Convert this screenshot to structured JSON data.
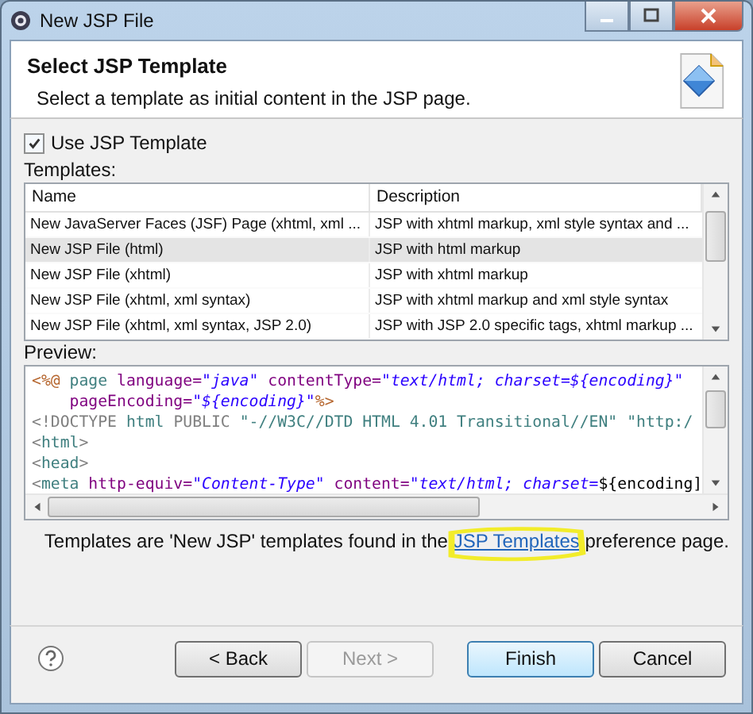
{
  "window": {
    "title": "New JSP File"
  },
  "header": {
    "title": "Select JSP Template",
    "description": "Select a template as initial content in the JSP page."
  },
  "use_template": {
    "label": "Use JSP Template",
    "checked": true
  },
  "templates": {
    "label": "Templates:",
    "columns": [
      "Name",
      "Description"
    ],
    "rows": [
      {
        "name": "New JavaServer Faces (JSF) Page (xhtml, xml ...",
        "description": "JSP with xhtml markup, xml style syntax and ...",
        "selected": false
      },
      {
        "name": "New JSP File (html)",
        "description": "JSP with html markup",
        "selected": true
      },
      {
        "name": "New JSP File (xhtml)",
        "description": "JSP with xhtml markup",
        "selected": false
      },
      {
        "name": "New JSP File (xhtml, xml syntax)",
        "description": "JSP with xhtml markup and xml style syntax",
        "selected": false
      },
      {
        "name": "New JSP File (xhtml, xml syntax, JSP 2.0)",
        "description": "JSP with JSP 2.0 specific tags, xhtml markup ...",
        "selected": false
      }
    ]
  },
  "preview": {
    "label": "Preview:",
    "lines": [
      [
        {
          "kind": "directive",
          "text": "<%@"
        },
        {
          "kind": "tag",
          "text": " page"
        },
        {
          "kind": "attr",
          "text": " language="
        },
        {
          "kind": "value",
          "text": "\"java\""
        },
        {
          "kind": "attr",
          "text": " contentType="
        },
        {
          "kind": "value",
          "text": "\"text/html; charset=${encoding}\""
        }
      ],
      [
        {
          "kind": "attr",
          "text": "    pageEncoding="
        },
        {
          "kind": "value",
          "text": "\"${encoding}\""
        },
        {
          "kind": "directive",
          "text": "%>"
        }
      ],
      [
        {
          "kind": "punct",
          "text": "<!DOCTYPE"
        },
        {
          "kind": "tag",
          "text": " html"
        },
        {
          "kind": "punct",
          "text": " PUBLIC"
        },
        {
          "kind": "string",
          "text": " \"-//W3C//DTD HTML 4.01 Transitional//EN\" \"http:/"
        }
      ],
      [
        {
          "kind": "punct",
          "text": "<"
        },
        {
          "kind": "tag",
          "text": "html"
        },
        {
          "kind": "punct",
          "text": ">"
        }
      ],
      [
        {
          "kind": "punct",
          "text": "<"
        },
        {
          "kind": "tag",
          "text": "head"
        },
        {
          "kind": "punct",
          "text": ">"
        }
      ],
      [
        {
          "kind": "punct",
          "text": "<"
        },
        {
          "kind": "tag",
          "text": "meta"
        },
        {
          "kind": "attr",
          "text": " http-equiv="
        },
        {
          "kind": "value",
          "text": "\"Content-Type\""
        },
        {
          "kind": "attr",
          "text": " content="
        },
        {
          "kind": "value",
          "text": "\"text/html; charset="
        },
        {
          "kind": "plain",
          "text": "${encoding]"
        }
      ]
    ]
  },
  "note": {
    "before": "Templates are 'New JSP' templates found in the ",
    "link": "JSP Templates",
    "after": " preference page."
  },
  "buttons": [
    {
      "label": "< Back",
      "disabled": false,
      "default": false
    },
    {
      "label": "Next >",
      "disabled": true,
      "default": false
    },
    {
      "label": "Finish",
      "disabled": false,
      "default": true
    },
    {
      "label": "Cancel",
      "disabled": false,
      "default": false
    }
  ]
}
